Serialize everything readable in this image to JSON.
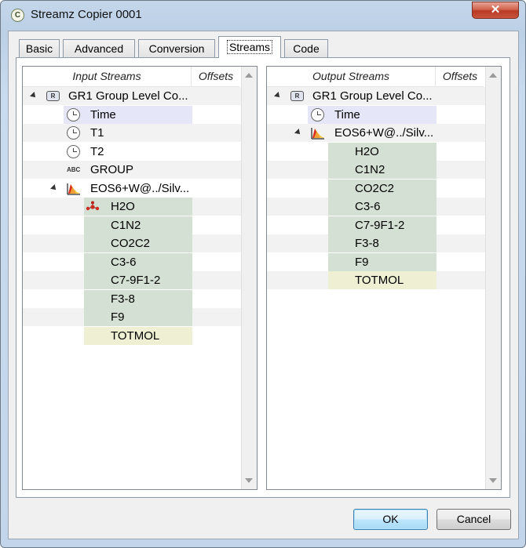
{
  "window": {
    "title": "Streamz Copier 0001",
    "close_glyph": "✕",
    "app_icon_letter": "C"
  },
  "tabs": [
    {
      "label": "Basic",
      "active": false
    },
    {
      "label": "Advanced",
      "active": false
    },
    {
      "label": "Conversion",
      "active": false
    },
    {
      "label": "Streams",
      "active": true
    },
    {
      "label": "Code",
      "active": false
    }
  ],
  "input_tree": {
    "header": {
      "name": "Input Streams",
      "offsets": "Offsets"
    },
    "rows": [
      {
        "text": "GR1 Group Level Co...",
        "icon": "r-icon",
        "icon_text": "R",
        "expanded": true,
        "level": 0
      },
      {
        "text": "Time",
        "icon": "clock-icon",
        "highlight": "time",
        "level": 1
      },
      {
        "text": "T1",
        "icon": "clock-icon",
        "level": 1
      },
      {
        "text": "T2",
        "icon": "clock-icon",
        "level": 1
      },
      {
        "text": "GROUP",
        "icon": "abc-icon",
        "icon_text": "ABC",
        "level": 1
      },
      {
        "text": "EOS6+W@../Silv...",
        "icon": "eos-icon",
        "expanded": true,
        "level": 1
      },
      {
        "text": "H2O",
        "icon": "h2o-icon",
        "highlight": "comp",
        "level": 2
      },
      {
        "text": "C1N2",
        "highlight": "comp",
        "level": 2
      },
      {
        "text": "CO2C2",
        "highlight": "comp",
        "level": 2
      },
      {
        "text": "C3-6",
        "highlight": "comp",
        "level": 2
      },
      {
        "text": "C7-9F1-2",
        "highlight": "comp",
        "level": 2
      },
      {
        "text": "F3-8",
        "highlight": "comp",
        "level": 2
      },
      {
        "text": "F9",
        "highlight": "comp",
        "level": 2
      },
      {
        "text": "TOTMOL",
        "highlight": "tot",
        "level": 2
      }
    ]
  },
  "output_tree": {
    "header": {
      "name": "Output Streams",
      "offsets": "Offsets"
    },
    "rows": [
      {
        "text": "GR1 Group Level Co...",
        "icon": "r-icon",
        "icon_text": "R",
        "expanded": true,
        "level": 0
      },
      {
        "text": "Time",
        "icon": "clock-icon",
        "highlight": "time",
        "level": 1
      },
      {
        "text": "EOS6+W@../Silv...",
        "icon": "eos-icon",
        "expanded": true,
        "level": 1
      },
      {
        "text": "H2O",
        "highlight": "comp",
        "level": 2
      },
      {
        "text": "C1N2",
        "highlight": "comp",
        "level": 2
      },
      {
        "text": "CO2C2",
        "highlight": "comp",
        "level": 2
      },
      {
        "text": "C3-6",
        "highlight": "comp",
        "level": 2
      },
      {
        "text": "C7-9F1-2",
        "highlight": "comp",
        "level": 2
      },
      {
        "text": "F3-8",
        "highlight": "comp",
        "level": 2
      },
      {
        "text": "F9",
        "highlight": "comp",
        "level": 2
      },
      {
        "text": "TOTMOL",
        "highlight": "tot",
        "level": 2
      }
    ]
  },
  "buttons": {
    "ok": "OK",
    "cancel": "Cancel"
  }
}
